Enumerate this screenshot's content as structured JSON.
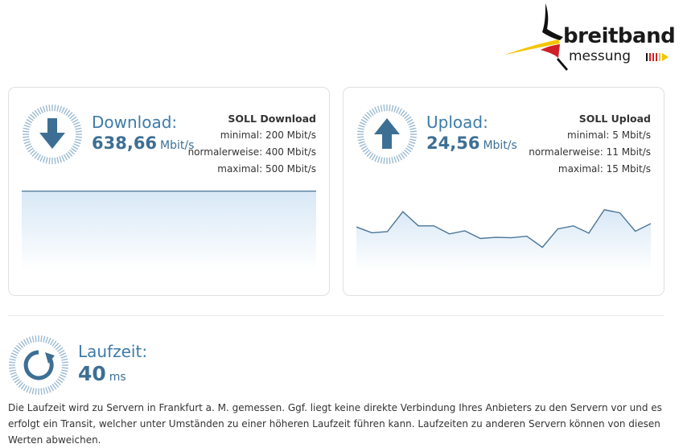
{
  "logo": {
    "word_main": "breitband",
    "word_sub": "messung"
  },
  "download": {
    "label": "Download:",
    "value": "638,66",
    "unit": "Mbit/s",
    "soll": {
      "title": "SOLL Download",
      "minimal": "minimal: 200 Mbit/s",
      "normal": "normalerweise: 400 Mbit/s",
      "maximal": "maximal: 500 Mbit/s"
    },
    "series": [
      638,
      638,
      638,
      638,
      638,
      638,
      638,
      638,
      638,
      638,
      638,
      638,
      638,
      638,
      638,
      638,
      638,
      638,
      638,
      638
    ]
  },
  "upload": {
    "label": "Upload:",
    "value": "24,56",
    "unit": "Mbit/s",
    "soll": {
      "title": "SOLL Upload",
      "minimal": "minimal: 5 Mbit/s",
      "normal": "normalerweise: 11 Mbit/s",
      "maximal": "maximal: 15 Mbit/s"
    },
    "series": [
      26.5,
      25,
      25.3,
      30.5,
      26.8,
      26.8,
      24.7,
      25.5,
      23.5,
      23.8,
      23.7,
      24.1,
      21.2,
      26,
      26.8,
      24.9,
      31,
      30.2,
      25.4,
      27.4
    ]
  },
  "latency": {
    "label": "Laufzeit:",
    "value": "40",
    "unit": "ms"
  },
  "info_text": "Die Laufzeit wird zu Servern in Frankfurt a. M. gemessen. Ggf. liegt keine direkte Verbindung Ihres Anbieters zu den Servern vor und es erfolgt ein Transit, welcher unter Umständen zu einer höheren Laufzeit führen kann. Laufzeiten zu anderen Servern können von diesen Werten abweichen.",
  "colors": {
    "accent": "#3d7ba8",
    "chart_line": "#4a7597",
    "chart_fill_top": "#d8e8f6",
    "chart_fill_bottom": "#ffffff",
    "flag_black": "#000000",
    "flag_red": "#d01f27",
    "flag_gold": "#f5c400"
  }
}
